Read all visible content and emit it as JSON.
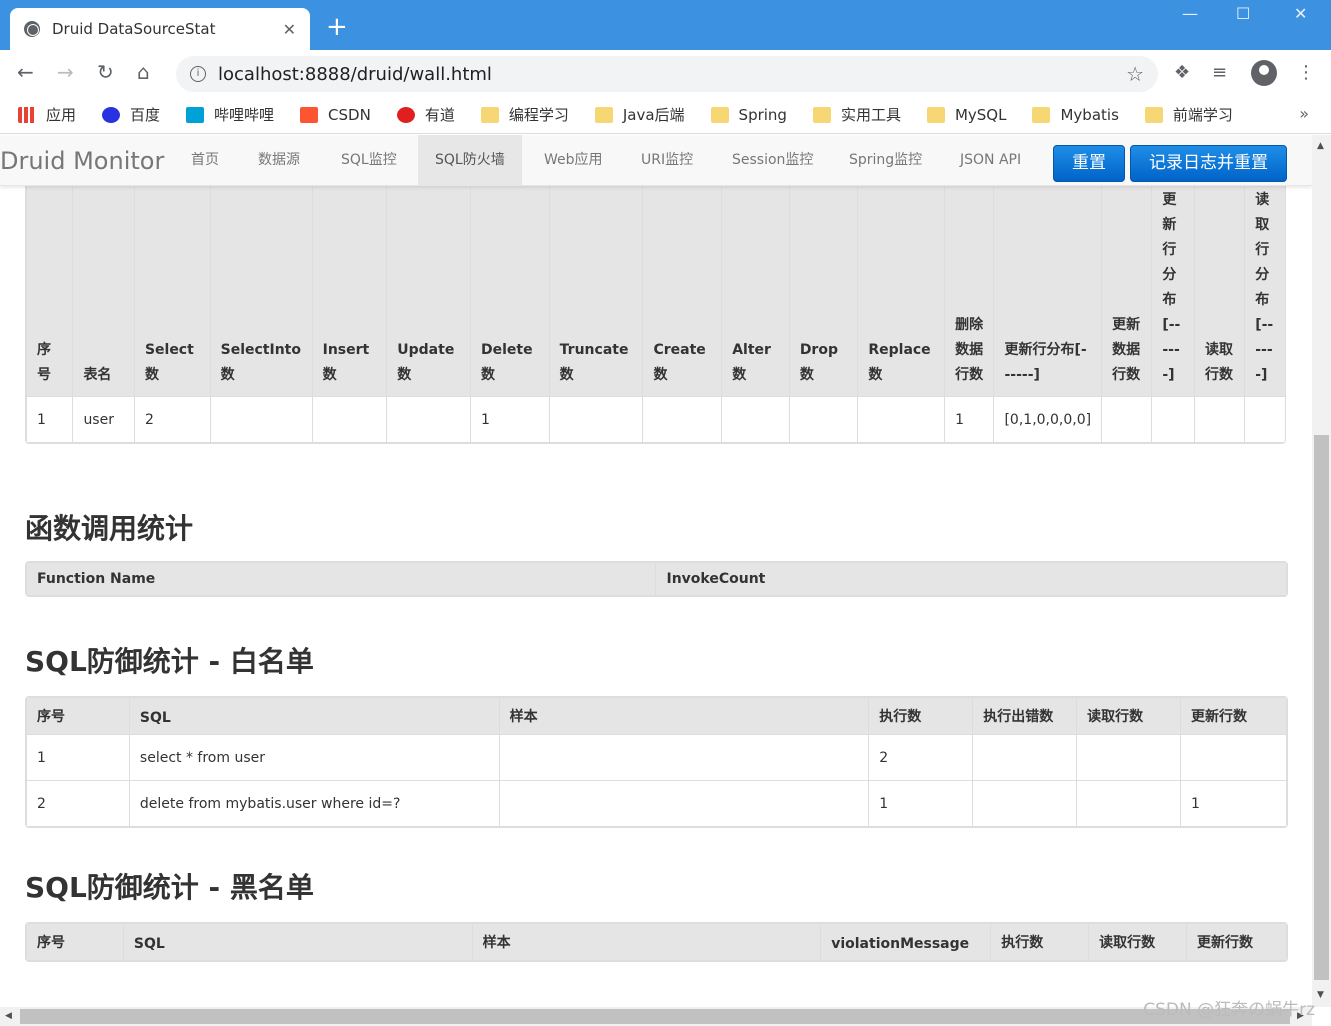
{
  "browser": {
    "tab_title": "Druid DataSourceStat",
    "tab_close": "✕",
    "new_tab": "+",
    "url": "localhost:8888/druid/wall.html",
    "window_min": "—",
    "window_max": "☐",
    "window_close": "✕"
  },
  "bookmarks": {
    "items": [
      "应用",
      "百度",
      "哔哩哔哩",
      "CSDN",
      "有道",
      "编程学习",
      "Java后端",
      "Spring",
      "实用工具",
      "MySQL",
      "Mybatis",
      "前端学习"
    ],
    "more": "»"
  },
  "navbar": {
    "brand": "Druid Monitor",
    "items": [
      "首页",
      "数据源",
      "SQL监控",
      "SQL防火墙",
      "Web应用",
      "URI监控",
      "Session监控",
      "Spring监控",
      "JSON API"
    ],
    "active": "SQL防火墙",
    "reset_button": "重置",
    "log_reset_button": "记录日志并重置"
  },
  "table_stats": {
    "headers": [
      "序号",
      "表名",
      "Select数",
      "SelectInto数",
      "Insert数",
      "Update数",
      "Delete数",
      "Truncate数",
      "Create数",
      "Alter数",
      "Drop数",
      "Replace数",
      "删除数据行数",
      "更新行分布[------]",
      "更新数据行数",
      "更新行分布[------]",
      "读取行数",
      "读取行分布[------]"
    ],
    "rows": [
      [
        "1",
        "user",
        "2",
        "",
        "",
        "",
        "1",
        "",
        "",
        "",
        "",
        "",
        "1",
        "[0,1,0,0,0,0]",
        "",
        "",
        "",
        ""
      ]
    ]
  },
  "function_stats": {
    "title": "函数调用统计",
    "headers": [
      "Function Name",
      "InvokeCount"
    ],
    "rows": []
  },
  "whitelist": {
    "title": "SQL防御统计 - 白名单",
    "headers": [
      "序号",
      "SQL",
      "样本",
      "执行数",
      "执行出错数",
      "读取行数",
      "更新行数"
    ],
    "rows": [
      [
        "1",
        "select * from user",
        "",
        "2",
        "",
        "",
        ""
      ],
      [
        "2",
        "delete from mybatis.user where id=?",
        "",
        "1",
        "",
        "",
        "1"
      ]
    ]
  },
  "blacklist": {
    "title": "SQL防御统计 - 黑名单",
    "headers": [
      "序号",
      "SQL",
      "样本",
      "violationMessage",
      "执行数",
      "读取行数",
      "更新行数"
    ],
    "rows": []
  },
  "watermark": "CSDN @狂奔の蜗牛rz"
}
